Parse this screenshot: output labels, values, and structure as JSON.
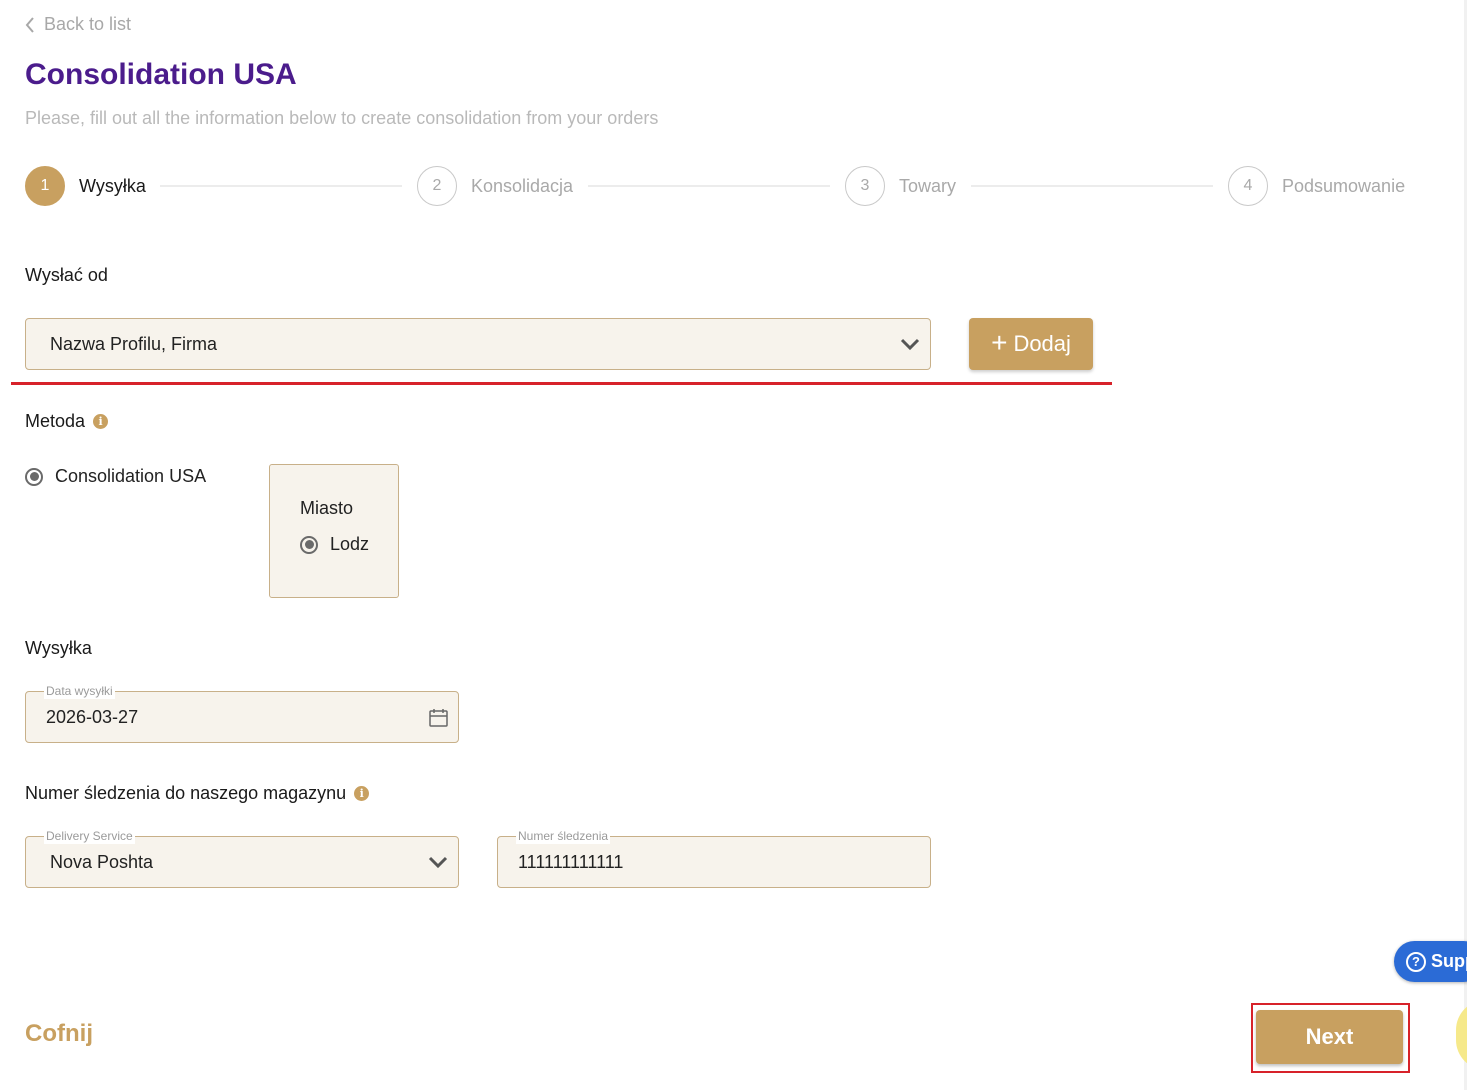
{
  "nav": {
    "back_label": "Back to list"
  },
  "header": {
    "title": "Consolidation USA",
    "subtitle": "Please, fill out all the information below to create consolidation from your orders"
  },
  "stepper": {
    "steps": [
      {
        "number": "1",
        "label": "Wysyłka",
        "active": true
      },
      {
        "number": "2",
        "label": "Konsolidacja",
        "active": false
      },
      {
        "number": "3",
        "label": "Towary",
        "active": false
      },
      {
        "number": "4",
        "label": "Podsumowanie",
        "active": false
      }
    ]
  },
  "send_from": {
    "label": "Wysłać od",
    "selected_value": "Nazwa Profilu, Firma",
    "add_button_label": "Dodaj"
  },
  "method": {
    "label": "Metoda",
    "option_label": "Consolidation USA",
    "city_title": "Miasto",
    "city_option": "Lodz"
  },
  "shipping": {
    "label": "Wysyłka",
    "date_legend": "Data wysyłki",
    "date_value": "2026-03-27"
  },
  "tracking": {
    "label": "Numer śledzenia do naszego magazynu",
    "service_legend": "Delivery Service",
    "service_value": "Nova Poshta",
    "number_legend": "Numer śledzenia",
    "number_value": "111111111111"
  },
  "footer": {
    "back_label": "Cofnij",
    "next_label": "Next"
  },
  "support": {
    "label": "Supp"
  },
  "colors": {
    "accent": "#c8a060",
    "title": "#4b1c8c",
    "field_bg": "#f7f3ec",
    "highlight": "#d7222a",
    "support": "#2b6bd6"
  }
}
